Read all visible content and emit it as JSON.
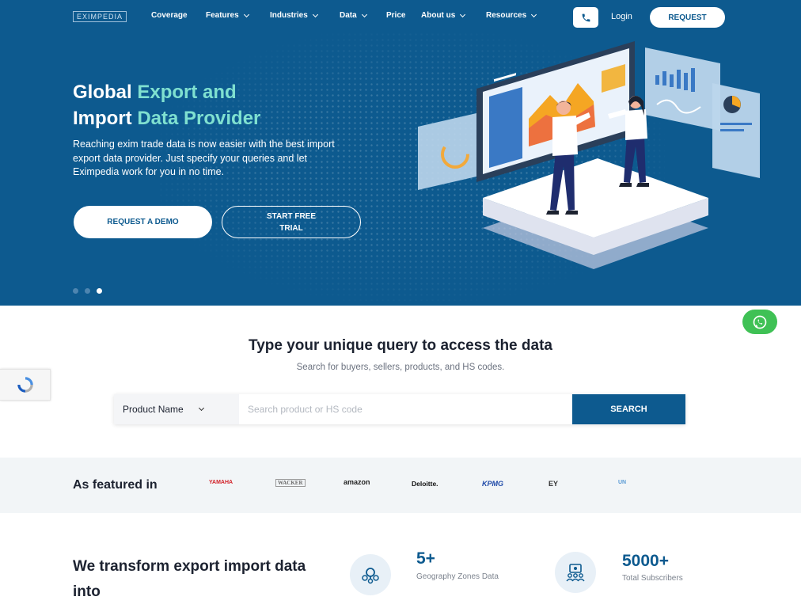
{
  "nav": {
    "logo": "EXIMPEDIA",
    "items": [
      {
        "label": "Coverage",
        "has_dropdown": false
      },
      {
        "label": "Features",
        "has_dropdown": true
      },
      {
        "label": "Industries",
        "has_dropdown": true
      },
      {
        "label": "Data",
        "has_dropdown": true
      },
      {
        "label": "Price",
        "has_dropdown": false
      },
      {
        "label": "About us",
        "has_dropdown": true
      },
      {
        "label": "Resources",
        "has_dropdown": true
      }
    ],
    "login": "Login",
    "request": "REQUEST"
  },
  "hero": {
    "title_line1_prefix": "Global ",
    "title_line1_accent": "Export and",
    "title_line2_prefix": "Import ",
    "title_line2_accent": "Data Provider",
    "description": "Reaching exim trade data is now easier with the best import export data provider. Just specify your queries and let Eximpedia work for you in no time.",
    "btn_demo": "REQUEST A DEMO",
    "btn_trial": "START FREE TRIAL",
    "slides": 3,
    "active_slide": 2
  },
  "search": {
    "title": "Type your unique query to access the data",
    "subtitle": "Search for buyers, sellers, products, and HS codes.",
    "select_value": "Product Name",
    "placeholder": "Search product or HS code",
    "button": "SEARCH"
  },
  "featured": {
    "label": "As featured in",
    "brands": [
      {
        "name": "YAMAHA",
        "color": "#d2232a"
      },
      {
        "name": "WACKER",
        "color": "#6b6b6b"
      },
      {
        "name": "amazon",
        "color": "#222222"
      },
      {
        "name": "Deloitte.",
        "color": "#111111"
      },
      {
        "name": "KPMG",
        "color": "#1e49a8"
      },
      {
        "name": "EY",
        "color": "#333333"
      },
      {
        "name": "UN",
        "color": "#5b9bd5"
      }
    ]
  },
  "stats": {
    "heading": "We transform export import data into",
    "items": [
      {
        "value": "5+",
        "label": "Geography Zones Data",
        "icon": "map-pin-icon"
      },
      {
        "value": "5000+",
        "label": "Total Subscribers",
        "icon": "users-icon"
      }
    ]
  },
  "colors": {
    "primary": "#0d5a8f",
    "accent": "#7fe0d0",
    "whatsapp": "#3fc155"
  }
}
